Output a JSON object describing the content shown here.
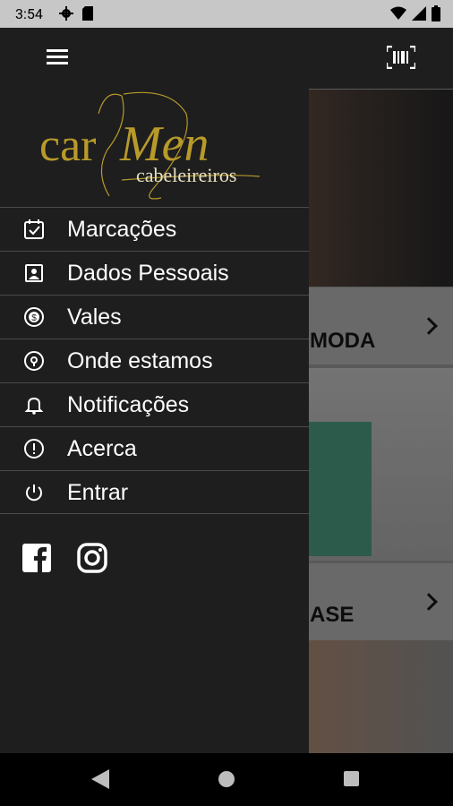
{
  "status_bar": {
    "time": "3:54"
  },
  "content": {
    "card1_title": "MODA",
    "card2_title": "ASE"
  },
  "logo": {
    "brand_part1": "car",
    "brand_part2": "Men",
    "tagline": "cabeleireiros",
    "color": "#b89a2a"
  },
  "menu": {
    "items": [
      {
        "label": "Marcações",
        "icon": "calendar-check-icon"
      },
      {
        "label": "Dados Pessoais",
        "icon": "contact-card-icon"
      },
      {
        "label": "Vales",
        "icon": "coin-icon"
      },
      {
        "label": "Onde estamos",
        "icon": "location-pin-icon"
      },
      {
        "label": "Notificações",
        "icon": "bell-icon"
      },
      {
        "label": "Acerca",
        "icon": "info-alert-icon"
      },
      {
        "label": "Entrar",
        "icon": "power-icon"
      }
    ]
  },
  "social": [
    "facebook-icon",
    "instagram-icon"
  ],
  "colors": {
    "drawer_bg": "#1e1e1e",
    "accent_gold": "#b89a2a",
    "text": "#ffffff"
  }
}
